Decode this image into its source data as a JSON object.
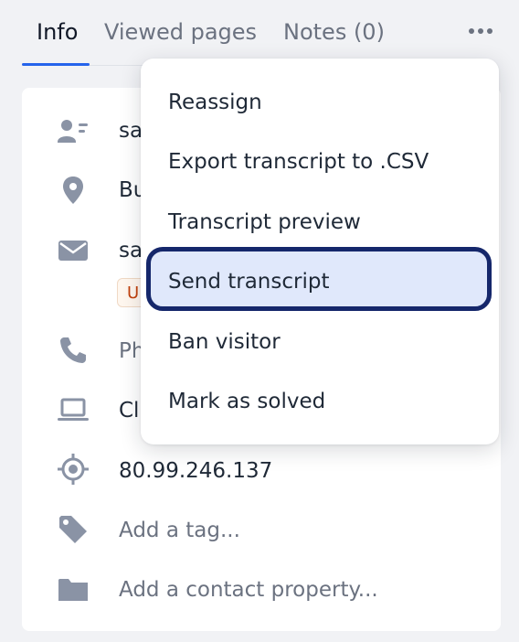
{
  "tabs": {
    "info": "Info",
    "viewed_pages": "Viewed pages",
    "notes": "Notes (0)"
  },
  "details": {
    "name": "sa",
    "location": "Bu",
    "email": "sa",
    "badge": "U",
    "phone": "Ph",
    "device": "Cl",
    "ip": "80.99.246.137",
    "add_tag": "Add a tag...",
    "add_contact_property": "Add a contact property..."
  },
  "menu": {
    "items": [
      "Reassign",
      "Export transcript to .CSV",
      "Transcript preview",
      "Send transcript",
      "Ban visitor",
      "Mark as solved"
    ]
  },
  "colors": {
    "accent": "#2563eb",
    "highlight_border": "#15276b",
    "highlight_fill": "#e0e8fb",
    "icon": "#8a93a5"
  }
}
